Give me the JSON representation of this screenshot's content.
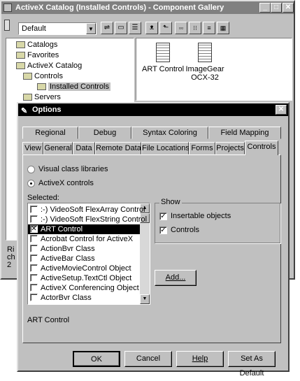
{
  "gallery": {
    "title": "ActiveX Catalog (Installed Controls) - Component Gallery",
    "dropdown_value": "Default",
    "tree": [
      {
        "label": "Catalogs"
      },
      {
        "label": "Favorites"
      },
      {
        "label": "ActiveX Catalog"
      },
      {
        "label": "Controls"
      },
      {
        "label": "Installed Controls"
      },
      {
        "label": "Servers"
      }
    ],
    "items": [
      {
        "label": "ART Control"
      },
      {
        "label": "ImageGear OCX-32"
      }
    ],
    "status_left": [
      "Ri",
      "ch",
      "2"
    ]
  },
  "options": {
    "title": "Options",
    "tabs_back": [
      "Regional",
      "Debug",
      "Syntax Coloring",
      "Field Mapping"
    ],
    "tabs_front": [
      "View",
      "General",
      "Data",
      "Remote Data",
      "File Locations",
      "Forms",
      "Projects",
      "Controls"
    ],
    "active_tab": "Controls",
    "radio_visual": "Visual class libraries",
    "radio_activex": "ActiveX controls",
    "selected_label": "Selected:",
    "list": [
      {
        "label": ":-) VideoSoft FlexArray Control",
        "checked": false
      },
      {
        "label": ":-) VideoSoft FlexString Control",
        "checked": false
      },
      {
        "label": "ART Control",
        "checked": true
      },
      {
        "label": "Acrobat Control for ActiveX",
        "checked": false
      },
      {
        "label": "ActionBvr Class",
        "checked": false
      },
      {
        "label": "ActiveBar Class",
        "checked": false
      },
      {
        "label": "ActiveMovieControl Object",
        "checked": false
      },
      {
        "label": "ActiveSetup.TextCtl Object",
        "checked": false
      },
      {
        "label": "ActiveX Conferencing Object",
        "checked": false
      },
      {
        "label": "ActorBvr Class",
        "checked": false
      }
    ],
    "show_group": "Show",
    "show_insertable": "Insertable objects",
    "show_controls": "Controls",
    "add_button": "Add...",
    "selected_name": "ART Control",
    "buttons": {
      "ok": "OK",
      "cancel": "Cancel",
      "help": "Help",
      "set_default": "Set As Default"
    }
  }
}
